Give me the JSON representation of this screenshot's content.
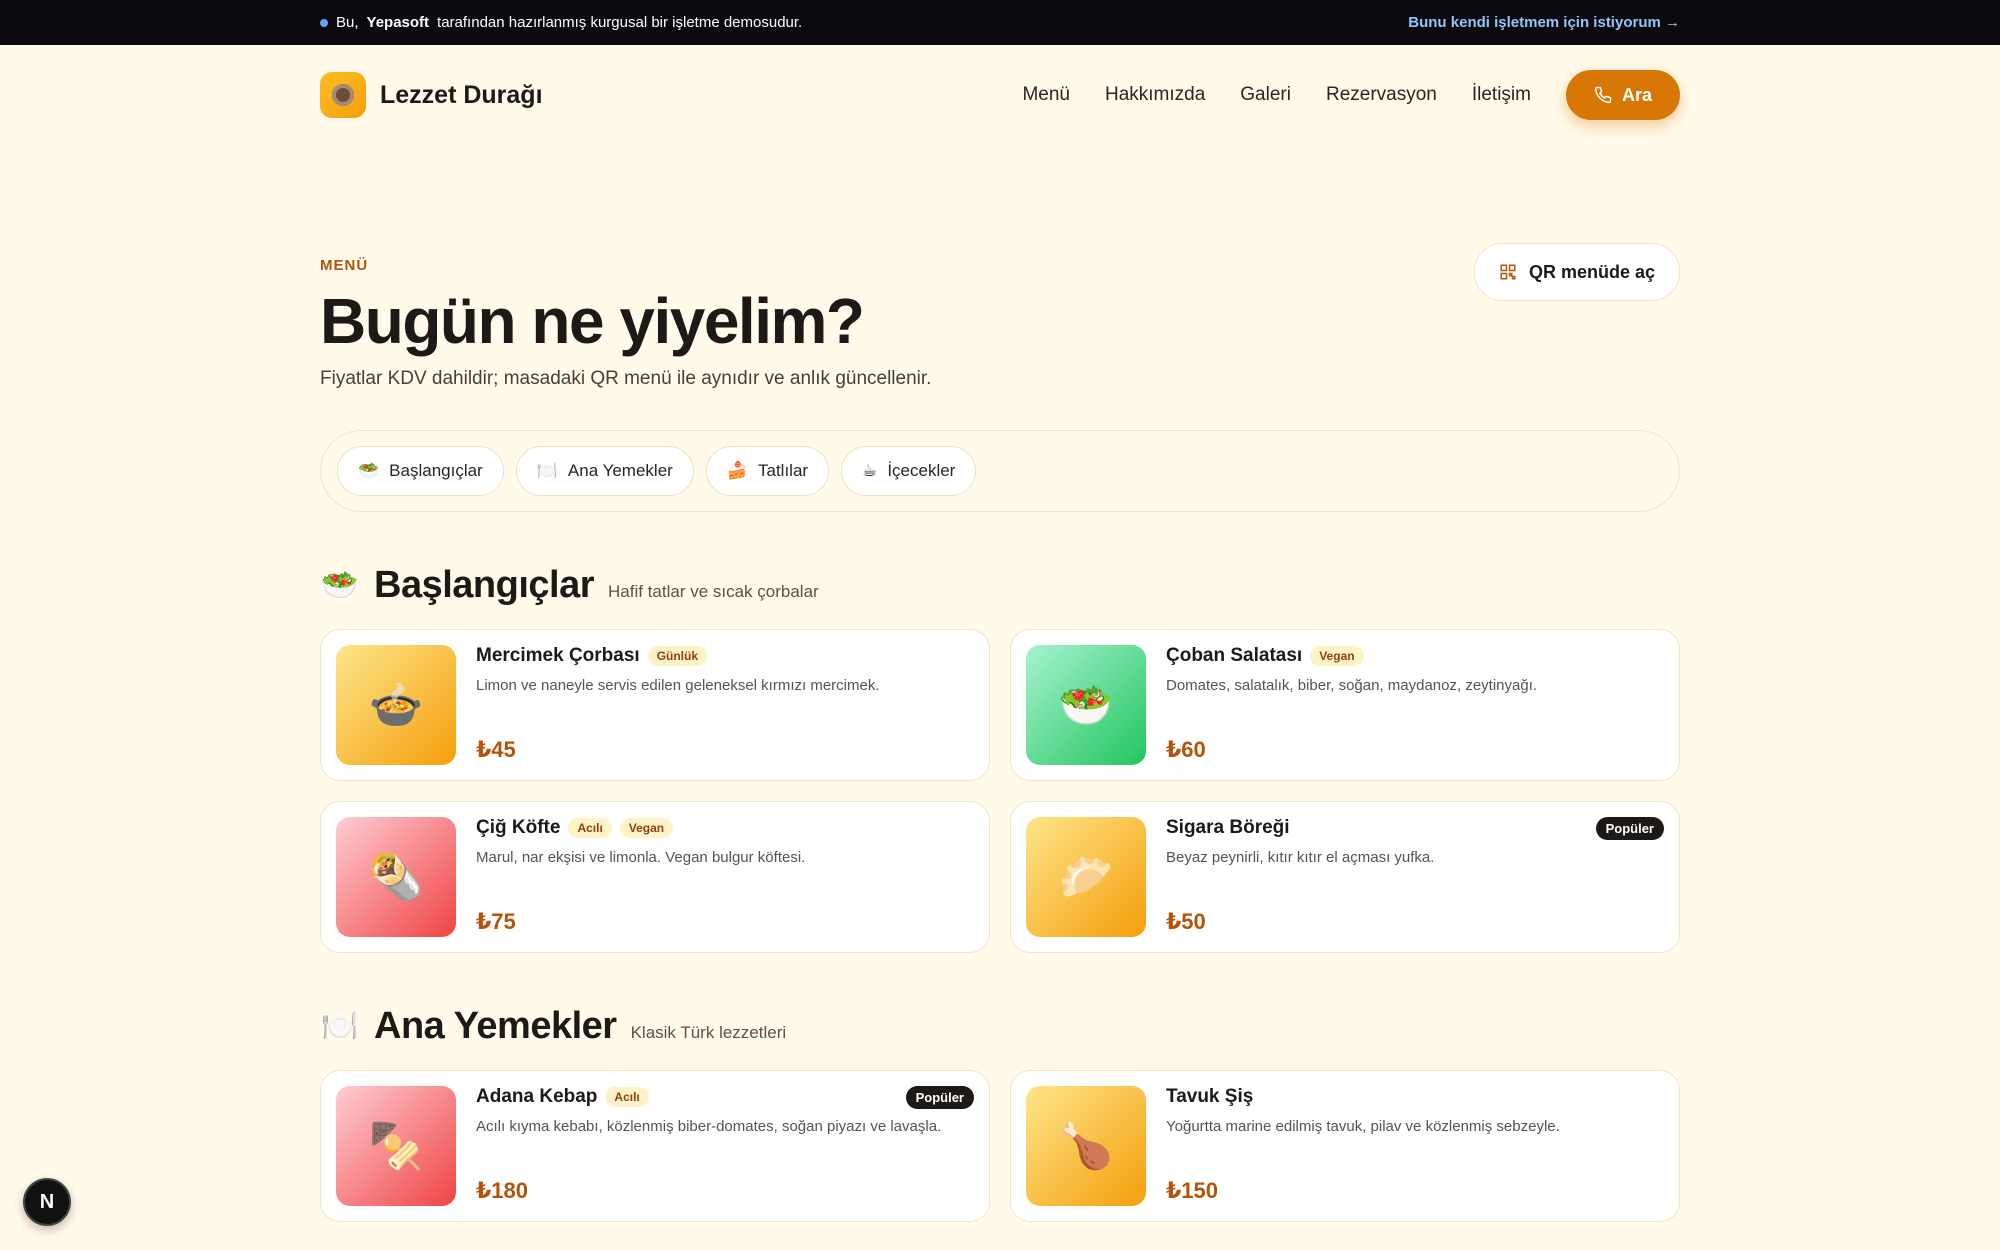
{
  "banner": {
    "text_prefix": "Bu,",
    "brand": "Yepasoft",
    "text_suffix": "tarafından hazırlanmış kurgusal bir işletme demosudur.",
    "cta": "Bunu kendi işletmem için istiyorum →"
  },
  "header": {
    "brand_name": "Lezzet Durağı",
    "nav": [
      "Menü",
      "Hakkımızda",
      "Galeri",
      "Rezervasyon",
      "İletişim"
    ],
    "call_label": "Ara"
  },
  "hero": {
    "eyebrow": "MENÜ",
    "title": "Bugün ne yiyelim?",
    "subtitle": "Fiyatlar KDV dahildir; masadaki QR menü ile aynıdır ve anlık güncellenir.",
    "qr_label": "QR menüde aç"
  },
  "tabs": [
    {
      "icon": "🥗",
      "label": "Başlangıçlar"
    },
    {
      "icon": "🍽️",
      "label": "Ana Yemekler"
    },
    {
      "icon": "🍰",
      "label": "Tatlılar"
    },
    {
      "icon": "☕",
      "label": "İçecekler"
    }
  ],
  "sections": [
    {
      "icon": "🥗",
      "title": "Başlangıçlar",
      "desc": "Hafif tatlar ve sıcak çorbalar",
      "items": [
        {
          "name": "Mercimek Çorbası",
          "tags": [
            "Günlük"
          ],
          "desc": "Limon ve naneyle servis edilen geleneksel kırmızı mercimek.",
          "price": "₺45",
          "icon": "🍲",
          "color": "amber",
          "popular": ""
        },
        {
          "name": "Çoban Salatası",
          "tags": [
            "Vegan"
          ],
          "desc": "Domates, salatalık, biber, soğan, maydanoz, zeytinyağı.",
          "price": "₺60",
          "icon": "🥗",
          "color": "green",
          "popular": ""
        },
        {
          "name": "Çiğ Köfte",
          "tags": [
            "Acılı",
            "Vegan"
          ],
          "desc": "Marul, nar ekşisi ve limonla. Vegan bulgur köftesi.",
          "price": "₺75",
          "icon": "🌯",
          "color": "red",
          "popular": ""
        },
        {
          "name": "Sigara Böreği",
          "tags": [],
          "desc": "Beyaz peynirli, kıtır kıtır el açması yufka.",
          "price": "₺50",
          "icon": "🥟",
          "color": "amber",
          "popular": "Popüler"
        }
      ]
    },
    {
      "icon": "🍽️",
      "title": "Ana Yemekler",
      "desc": "Klasik Türk lezzetleri",
      "items": [
        {
          "name": "Adana Kebap",
          "tags": [
            "Acılı"
          ],
          "desc": "Acılı kıyma kebabı, közlenmiş biber-domates, soğan piyazı ve lavaşla.",
          "price": "₺180",
          "icon": "🍢",
          "color": "red",
          "popular": "Popüler"
        },
        {
          "name": "Tavuk Şiş",
          "tags": [],
          "desc": "Yoğurtta marine edilmiş tavuk, pilav ve közlenmiş sebzeyle.",
          "price": "₺150",
          "icon": "🍗",
          "color": "amber",
          "popular": ""
        }
      ]
    }
  ],
  "floating_badge": "N"
}
